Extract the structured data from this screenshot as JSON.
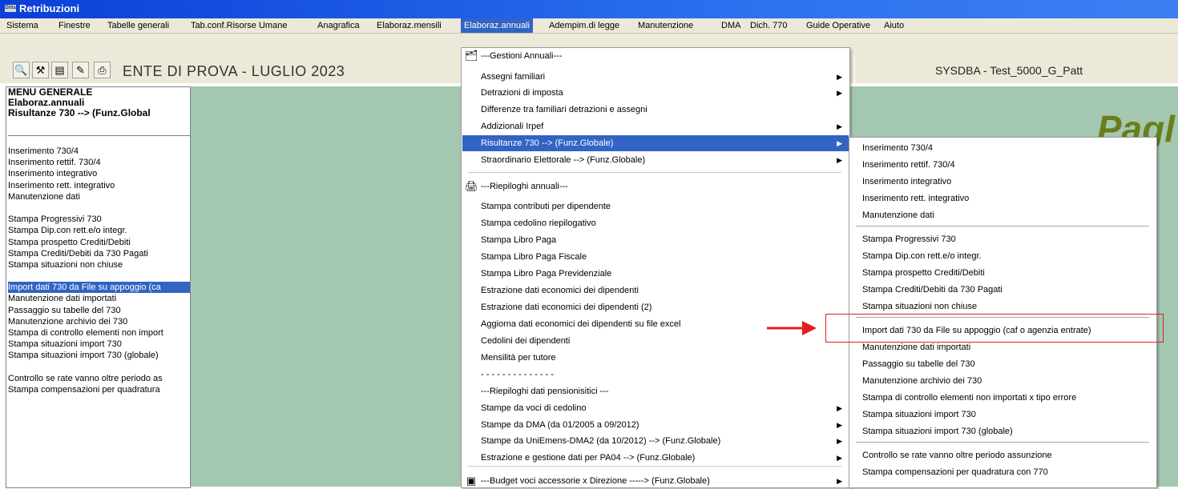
{
  "window": {
    "title": "Retribuzioni",
    "icon_text": "Ditta"
  },
  "menubar": {
    "items": [
      "Sistema",
      "Finestre",
      "Tabelle generali",
      "Tab.conf.Risorse Umane",
      "Anagrafica",
      "Elaboraz.mensili",
      "Elaboraz.annuali",
      "Adempim.di legge",
      "Manutenzione",
      "DMA",
      "Dich. 770",
      "Guide Operative",
      "Aiuto"
    ]
  },
  "toolbar": {
    "icons": [
      "search-icon",
      "tools-icon",
      "form-icon",
      "edit-icon",
      "print-icon"
    ],
    "ente_title": "ENTE DI PROVA - LUGLIO 2023",
    "db_label": "SYSDBA - Test_5000_G_Patt"
  },
  "left_panel": {
    "header": [
      "MENU GENERALE",
      "Elaboraz.annuali",
      " Risultanze 730 --> (Funz.Global"
    ],
    "items": [
      "Inserimento 730/4",
      "Inserimento rettif. 730/4",
      "Inserimento integrativo",
      "Inserimento rett. integrativo",
      "Manutenzione dati",
      "",
      "Stampa Progressivi 730",
      "Stampa Dip.con rett.e/o integr.",
      "Stampa prospetto Crediti/Debiti",
      "Stampa Crediti/Debiti da 730 Pagati",
      "Stampa situazioni non chiuse",
      "",
      "Import dati 730 da File su appoggio (ca",
      "Manutenzione dati importati",
      "Passaggio su tabelle del 730",
      "Manutenzione archivio dei 730",
      "Stampa di controllo elementi non import",
      "Stampa situazioni import 730",
      "Stampa situazioni import 730 (globale)",
      "",
      "Controllo se rate vanno oltre periodo as",
      "Stampa compensazioni per quadratura"
    ],
    "selected_index": 12
  },
  "background_logo": "Pagl",
  "dropdown": {
    "items": [
      {
        "label": "---Gestioni Annuali---",
        "icon": "folder-icon"
      },
      {
        "label": "Assegni familiari",
        "sub": true
      },
      {
        "label": "Detrazioni di imposta",
        "sub": true
      },
      {
        "label": "Differenze tra familiari detrazioni e assegni"
      },
      {
        "label": "Addizionali Irpef",
        "sub": true
      },
      {
        "label": "Risultanze 730 --> (Funz.Globale)",
        "sub": true,
        "active": true
      },
      {
        "label": "Straordinario Elettorale --> (Funz.Globale)",
        "sub": true
      },
      {
        "label": "---Riepiloghi annuali---",
        "icon": "printer-icon"
      },
      {
        "label": "Stampa contributi per dipendente"
      },
      {
        "label": "Stampa cedolino riepilogativo"
      },
      {
        "label": "Stampa Libro Paga"
      },
      {
        "label": "Stampa Libro Paga Fiscale"
      },
      {
        "label": "Stampa Libro Paga Previdenziale"
      },
      {
        "label": "Estrazione dati economici dei dipendenti"
      },
      {
        "label": "Estrazione dati economici dei dipendenti (2)"
      },
      {
        "label": "Aggiorna dati economici dei dipendenti su file excel"
      },
      {
        "label": "Cedolini dei dipendenti"
      },
      {
        "label": "Mensilità per tutore"
      },
      {
        "label": "- - - - - - - - - - - - - -"
      },
      {
        "label": "---Riepiloghi dati pensionisitici ---"
      },
      {
        "label": "Stampe da voci di cedolino",
        "sub": true
      },
      {
        "label": "Stampe da DMA (da 01/2005 a 09/2012)",
        "sub": true
      },
      {
        "label": "Stampe da UniEmens-DMA2 (da 10/2012)  --> (Funz.Globale)",
        "sub": true
      },
      {
        "label": "Estrazione e gestione dati per PA04  --> (Funz.Globale)",
        "sub": true
      },
      {
        "label": "---Budget voci accessorie x Direzione -----> (Funz.Globale)",
        "sub": true,
        "icon": "budget-icon"
      }
    ]
  },
  "submenu": {
    "items": [
      "Inserimento 730/4",
      "Inserimento rettif. 730/4",
      "Inserimento integrativo",
      "Inserimento rett. integrativo",
      "Manutenzione dati",
      "Stampa Progressivi 730",
      "Stampa Dip.con rett.e/o integr.",
      "Stampa prospetto Crediti/Debiti",
      "Stampa Crediti/Debiti da 730 Pagati",
      "Stampa situazioni non chiuse",
      "Import dati 730 da File su appoggio (caf o agenzia entrate)",
      "Manutenzione dati importati",
      "Passaggio su tabelle del 730",
      "Manutenzione archivio dei 730",
      "Stampa di controllo elementi non importati x tipo errore",
      "Stampa situazioni import 730",
      "Stampa situazioni import 730 (globale)",
      "Controllo se rate vanno oltre periodo assunzione",
      "Stampa compensazioni per quadratura con 770"
    ]
  },
  "colors": {
    "highlight": "#3164c4",
    "annotation": "#e81c1c",
    "background": "#a3c7b1"
  }
}
